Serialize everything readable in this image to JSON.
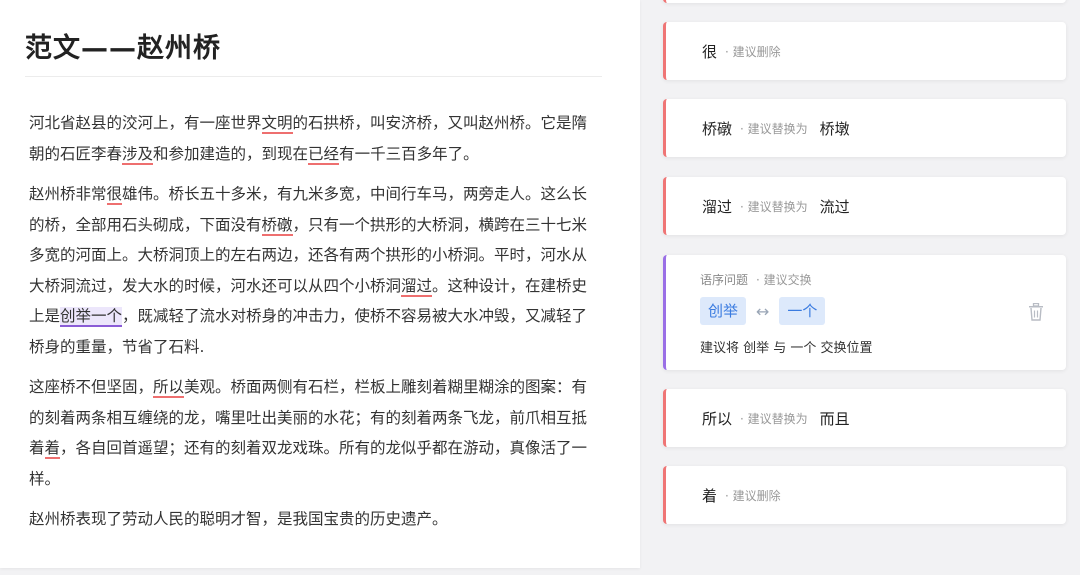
{
  "document": {
    "title": "范文——赵州桥",
    "p1": {
      "a": "河北省赵县的洨河上，有一座世界",
      "h1": "文明",
      "b": "的石拱桥，叫安济桥，又叫赵州桥。它是隋朝的石匠李春",
      "h2": "涉及",
      "c": "和参加建造的，到现在",
      "h3": "已经",
      "d": "有一千三百多年了。"
    },
    "p2": {
      "a": "赵州桥非常",
      "h1": "很",
      "b": "雄伟。桥长五十多米，有九米多宽，中间行车马，两旁走人。这么长的桥，全部用石头砌成，下面没有",
      "h2": "桥礅",
      "c": "，只有一个拱形的大桥洞，横跨在三十七米多宽的河面上。大桥洞顶上的左右两边，还各有两个拱形的小桥洞。平时，河水从大桥洞流过，发大水的时候，河水还可以从四个小桥洞",
      "h3": "溜过",
      "d": "。这种设计，在建桥史上是",
      "h4": "创举一个",
      "e": "，既减轻了流水对桥身的冲击力，使桥不容易被大水冲毁，又减轻了桥身的重量，节省了石料."
    },
    "p3": {
      "a": "这座桥不但坚固，",
      "h1": "所以",
      "b": "美观。桥面两侧有石栏，栏板上雕刻着糊里糊涂的图案：有的刻着两条相互缠绕的龙，嘴里吐出美丽的水花；有的刻着两条飞龙，前爪相互抵着",
      "h2": "着",
      "c": "，各自回首遥望；还有的刻着双龙戏珠。所有的龙似乎都在游动，真像活了一样。"
    },
    "p4": "赵州桥表现了劳动人民的聪明才智，是我国宝贵的历史遗产。"
  },
  "suggestions": [
    {
      "word": "很",
      "action": "· 建议删除"
    },
    {
      "word": "桥礅",
      "action": "· 建议替换为",
      "replacement": "桥墩"
    },
    {
      "word": "溜过",
      "action": "· 建议替换为",
      "replacement": "流过"
    },
    {
      "type": "语序问题",
      "action": "· 建议交换",
      "chip_a": "创举",
      "swap_symbol": "↔",
      "chip_b": "一个",
      "desc": "建议将 创举 与 一个 交换位置"
    },
    {
      "word": "所以",
      "action": "· 建议替换为",
      "replacement": "而且"
    },
    {
      "word": "着",
      "action": "· 建议删除"
    }
  ],
  "colors": {
    "error_accent": "#ef7575",
    "order_accent": "#9a6fe6",
    "chip_bg": "#dde9fb",
    "chip_text": "#3a7be0"
  },
  "icons": {
    "delete": "trash-icon"
  }
}
